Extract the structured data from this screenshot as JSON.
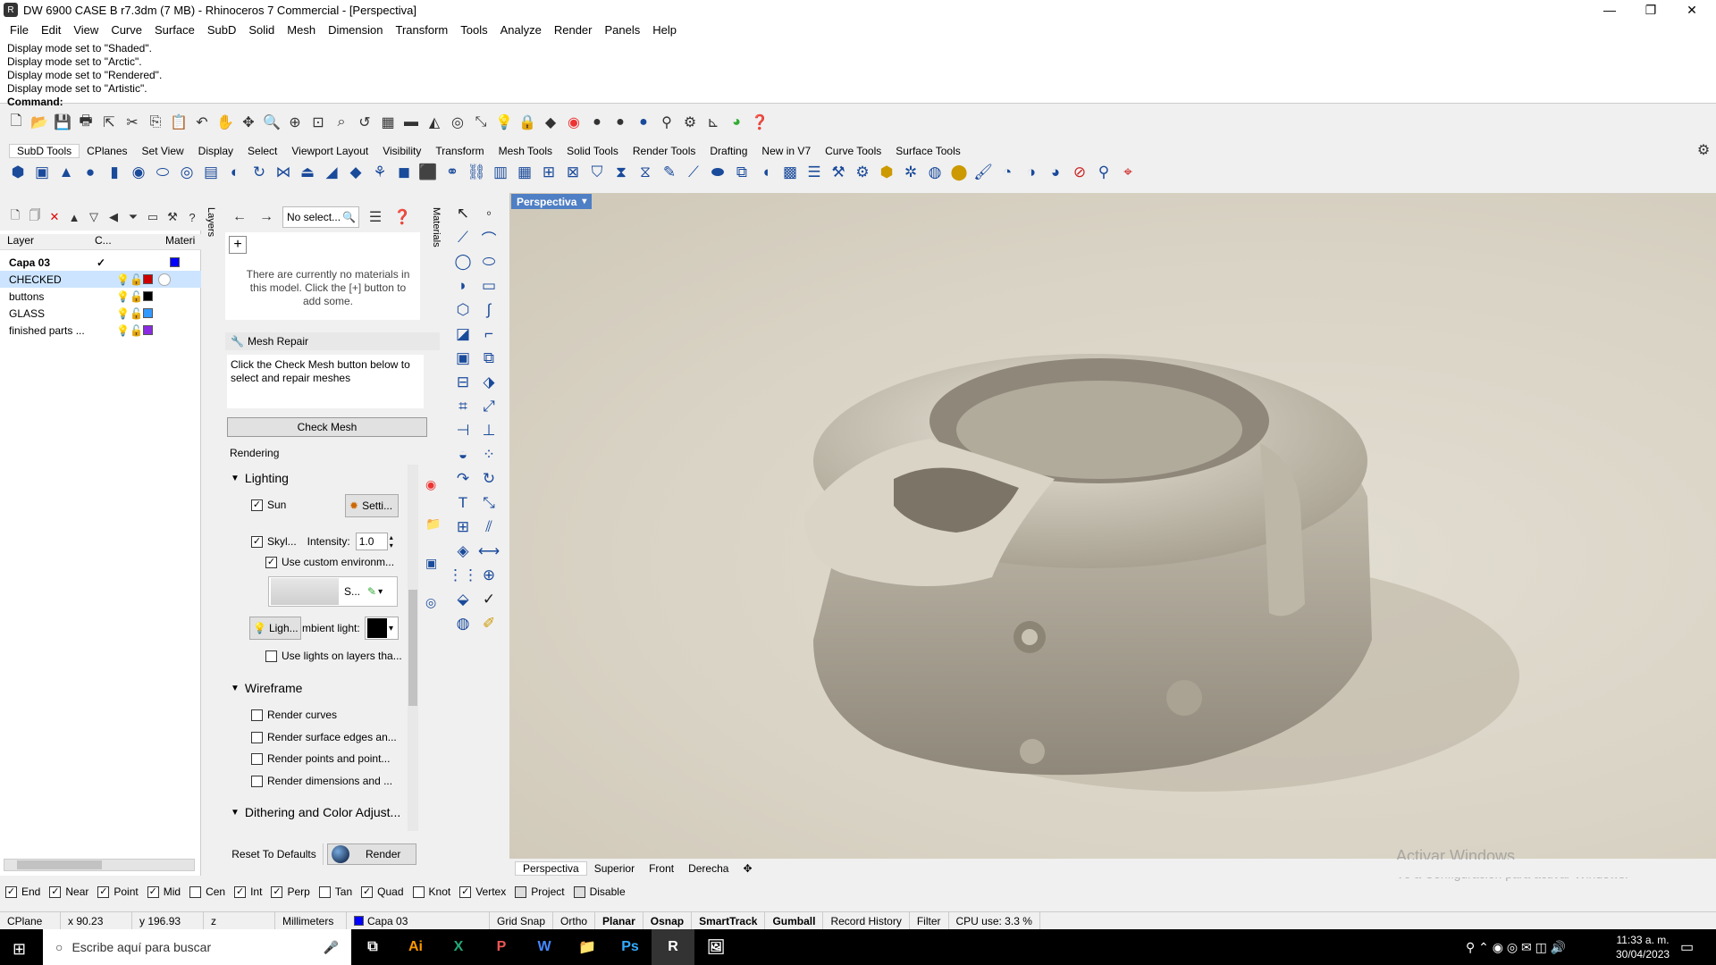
{
  "window": {
    "title": "DW 6900 CASE B r7.3dm (7 MB) - Rhinoceros 7 Commercial - [Perspectiva]"
  },
  "menu": [
    "File",
    "Edit",
    "View",
    "Curve",
    "Surface",
    "SubD",
    "Solid",
    "Mesh",
    "Dimension",
    "Transform",
    "Tools",
    "Analyze",
    "Render",
    "Panels",
    "Help"
  ],
  "history": {
    "lines": [
      "Display mode set to \"Shaded\".",
      "Display mode set to \"Arctic\".",
      "Display mode set to \"Rendered\".",
      "Display mode set to \"Artistic\"."
    ],
    "command_label": "Command:"
  },
  "toolbar_tabs": [
    "SubD Tools",
    "CPlanes",
    "Set View",
    "Display",
    "Select",
    "Viewport Layout",
    "Visibility",
    "Transform",
    "Mesh Tools",
    "Solid Tools",
    "Render Tools",
    "Drafting",
    "New in V7",
    "Curve Tools",
    "Surface Tools"
  ],
  "layers": {
    "side_tab": "Layers",
    "headers": {
      "name": "Layer",
      "current": "C...",
      "material": "Materi"
    },
    "rows": [
      {
        "name": "Capa 03",
        "current": "✓",
        "color": "#0000ff"
      },
      {
        "name": "CHECKED",
        "current": "",
        "color": "#ff0000"
      },
      {
        "name": "buttons",
        "current": "",
        "color": "#000000"
      },
      {
        "name": "GLASS",
        "current": "",
        "color": "#3399ff"
      },
      {
        "name": "finished parts ...",
        "current": "",
        "color": "#8a2be2"
      }
    ]
  },
  "materials": {
    "side_tab": "Materials",
    "search_text": "No select...",
    "empty_msg": "There are currently no materials in this model. Click the [+] button to add some."
  },
  "mesh_repair": {
    "title": "Mesh Repair",
    "desc": "Click the Check Mesh button below to select and repair meshes",
    "button": "Check Mesh"
  },
  "rendering": {
    "title": "Rendering",
    "lighting": "Lighting",
    "sun": "Sun",
    "sun_settings": "Setti...",
    "skylight": "Skyl...",
    "intensity_label": "Intensity:",
    "intensity_value": "1.0",
    "custom_env": "Use custom environm...",
    "env_short": "S...",
    "light_btn": "Ligh...",
    "ambient": "mbient light:",
    "use_lights_layers": "Use lights on layers tha...",
    "wireframe": "Wireframe",
    "render_curves": "Render curves",
    "render_surface_edges": "Render surface edges an...",
    "render_points": "Render points and point...",
    "render_dims": "Render dimensions and ...",
    "dithering": "Dithering and Color Adjust...",
    "reset": "Reset To Defaults",
    "render_btn": "Render"
  },
  "viewport": {
    "title": "Perspectiva",
    "tabs": [
      "Perspectiva",
      "Superior",
      "Front",
      "Derecha"
    ]
  },
  "osnap": [
    {
      "label": "End",
      "checked": true
    },
    {
      "label": "Near",
      "checked": true
    },
    {
      "label": "Point",
      "checked": true
    },
    {
      "label": "Mid",
      "checked": true
    },
    {
      "label": "Cen",
      "checked": false
    },
    {
      "label": "Int",
      "checked": true
    },
    {
      "label": "Perp",
      "checked": true
    },
    {
      "label": "Tan",
      "checked": false
    },
    {
      "label": "Quad",
      "checked": true
    },
    {
      "label": "Knot",
      "checked": false
    },
    {
      "label": "Vertex",
      "checked": true
    },
    {
      "label": "Project",
      "checked": false
    },
    {
      "label": "Disable",
      "checked": false
    }
  ],
  "status": {
    "cplane": "CPlane",
    "x": "x 90.23",
    "y": "y 196.93",
    "z": "z",
    "units": "Millimeters",
    "layer": "Capa 03",
    "layer_color": "#0000ff",
    "grid_snap": "Grid Snap",
    "ortho": "Ortho",
    "planar": "Planar",
    "osnap": "Osnap",
    "smarttrack": "SmartTrack",
    "gumball": "Gumball",
    "record_history": "Record History",
    "filter": "Filter",
    "cpu": "CPU use: 3.3 %"
  },
  "watermark": {
    "line1": "Activar Windows",
    "line2": "Ve a Configuración para activar Windows."
  },
  "taskbar": {
    "search_placeholder": "Escribe aquí para buscar",
    "time": "11:33 a. m.",
    "date": "30/04/2023",
    "apps": [
      "Ai",
      "X",
      "P",
      "W",
      "📁",
      "Ps",
      "R",
      "🖼"
    ]
  }
}
